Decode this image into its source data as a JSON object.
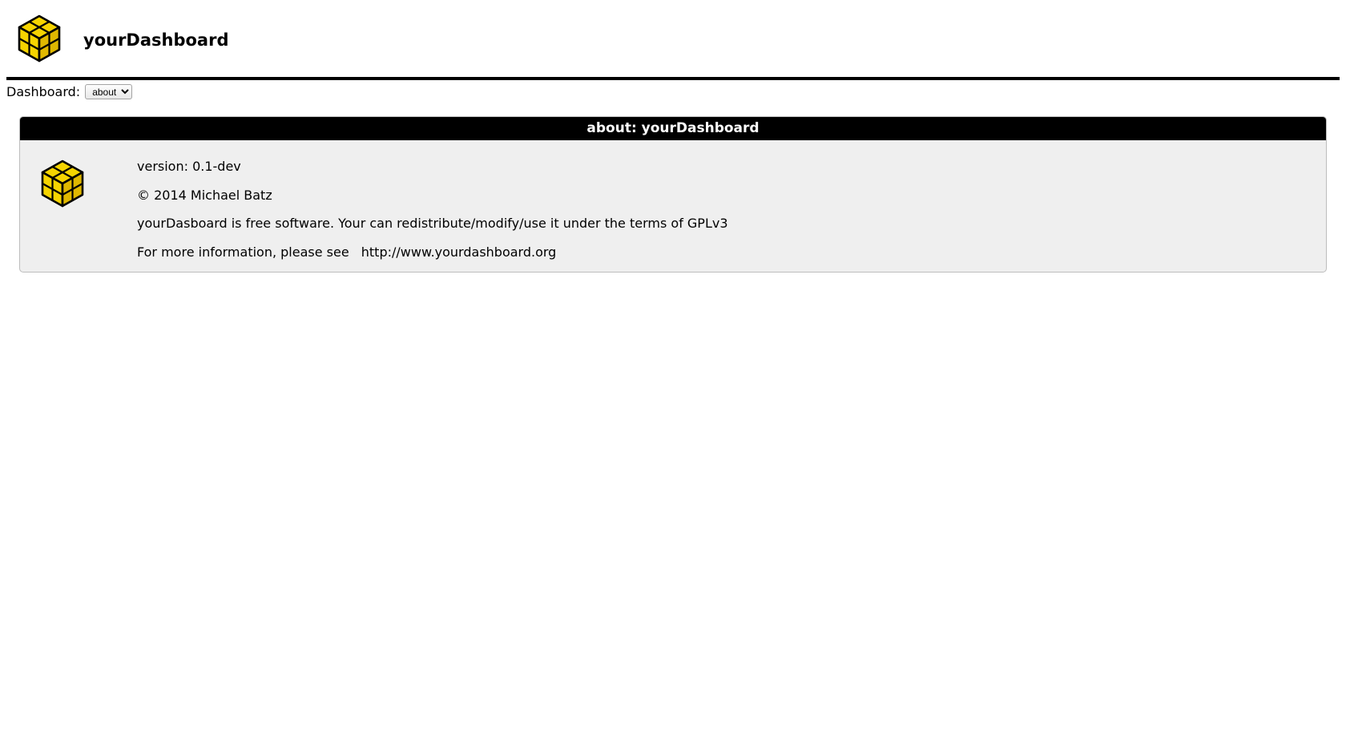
{
  "header": {
    "title": "yourDashboard"
  },
  "controls": {
    "dashboard_label": "Dashboard:",
    "dashboard_selected": "about"
  },
  "panel": {
    "title": "about: yourDashboard",
    "version_line": "version: 0.1-dev",
    "copyright_line": "© 2014 Michael Batz",
    "license_line": "yourDasboard is free software. Your can redistribute/modify/use it under the terms of GPLv3",
    "more_info_prefix": "For more information, please see ",
    "more_info_url": "http://www.yourdashboard.org"
  }
}
